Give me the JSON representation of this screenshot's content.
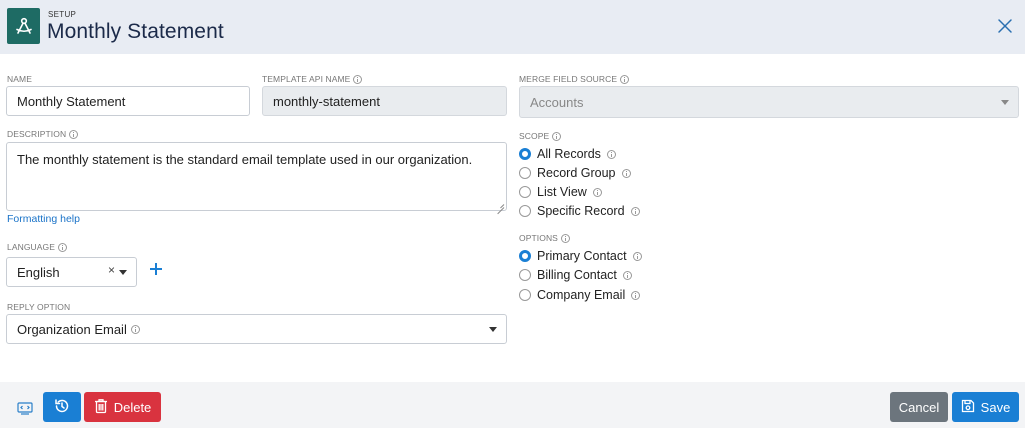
{
  "header": {
    "eyebrow": "SETUP",
    "title": "Monthly Statement"
  },
  "form": {
    "name": {
      "label": "NAME",
      "value": "Monthly Statement"
    },
    "template_api_name": {
      "label": "TEMPLATE API NAME",
      "value": "monthly-statement"
    },
    "merge_field_source": {
      "label": "MERGE FIELD SOURCE",
      "value": "Accounts"
    },
    "description": {
      "label": "DESCRIPTION",
      "value": "The monthly statement is the standard email template used in our organization."
    },
    "formatting_help": "Formatting help",
    "language": {
      "label": "LANGUAGE",
      "value": "English",
      "clear": "×"
    },
    "reply_option": {
      "label": "REPLY OPTION",
      "value": "Organization Email"
    },
    "scope": {
      "label": "SCOPE",
      "options": [
        "All Records",
        "Record Group",
        "List View",
        "Specific Record"
      ],
      "selected": "All Records"
    },
    "options": {
      "label": "OPTIONS",
      "options": [
        "Primary Contact",
        "Billing Contact",
        "Company Email"
      ],
      "selected": "Primary Contact"
    }
  },
  "footer": {
    "delete_label": "Delete",
    "cancel_label": "Cancel",
    "save_label": "Save"
  },
  "colors": {
    "primary": "#1a7fd4",
    "danger": "#d9333f",
    "secondary": "#6c757d",
    "header_bg": "#e8ecf3",
    "app_icon": "#1e6b64"
  },
  "icons": {
    "app": "compass-drafting-icon",
    "close": "close-icon",
    "history": "history-icon",
    "delete": "trash-icon",
    "save": "floppy-disk-icon",
    "code": "code-window-icon",
    "info": "info-icon",
    "add": "plus-icon"
  }
}
